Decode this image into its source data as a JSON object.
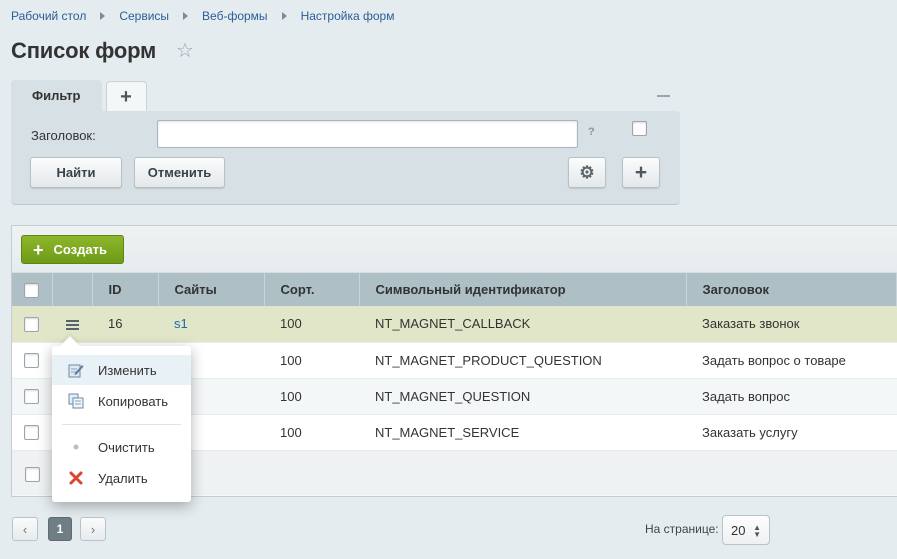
{
  "breadcrumb": [
    "Рабочий стол",
    "Сервисы",
    "Веб-формы",
    "Настройка форм"
  ],
  "page": {
    "title": "Список форм"
  },
  "filter": {
    "tab_label": "Фильтр",
    "add_tab_label": "+",
    "field_label": "Заголовок:",
    "field_value": "",
    "help": "?",
    "find_label": "Найти",
    "cancel_label": "Отменить"
  },
  "toolbar": {
    "create_label": "Создать"
  },
  "table": {
    "columns": [
      "ID",
      "Сайты",
      "Сорт.",
      "Символьный идентификатор",
      "Заголовок"
    ],
    "rows": [
      {
        "id": "16",
        "site": "s1",
        "sort": "100",
        "code": "NT_MAGNET_CALLBACK",
        "title": "Заказать звонок"
      },
      {
        "id": "",
        "site": "",
        "sort": "100",
        "code": "NT_MAGNET_PRODUCT_QUESTION",
        "title": "Задать вопрос о товаре"
      },
      {
        "id": "",
        "site": "",
        "sort": "100",
        "code": "NT_MAGNET_QUESTION",
        "title": "Задать вопрос"
      },
      {
        "id": "",
        "site": "",
        "sort": "100",
        "code": "NT_MAGNET_SERVICE",
        "title": "Заказать услугу"
      }
    ]
  },
  "context_menu": {
    "items": [
      {
        "label": "Изменить",
        "icon": "edit-icon"
      },
      {
        "label": "Копировать",
        "icon": "copy-icon"
      },
      {
        "label": "Очистить",
        "icon": "dot-icon"
      },
      {
        "label": "Удалить",
        "icon": "delete-icon"
      }
    ]
  },
  "pagination": {
    "current_page": "1",
    "per_page_label": "На странице:",
    "per_page_value": "20"
  },
  "colors": {
    "create_green": "#7aa51c",
    "selected_row": "#e0e6c7",
    "header_bg": "#aebfc6"
  }
}
